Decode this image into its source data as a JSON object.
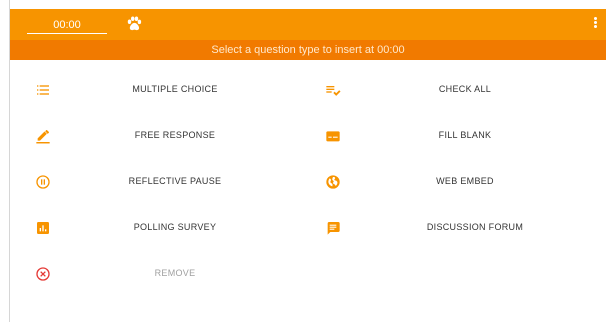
{
  "header": {
    "time_value": "00:00",
    "logo_icon": "paw-icon",
    "menu_icon": "more-vert-icon",
    "bar_color": "#f79400"
  },
  "banner": {
    "text": "Select a question type to insert at 00:00",
    "color": "#f17a00"
  },
  "question_types": [
    {
      "label": "MULTIPLE CHOICE",
      "icon": "list-icon"
    },
    {
      "label": "CHECK ALL",
      "icon": "playlist-check-icon"
    },
    {
      "label": "FREE RESPONSE",
      "icon": "pencil-icon"
    },
    {
      "label": "FILL BLANK",
      "icon": "fill-blank-icon"
    },
    {
      "label": "REFLECTIVE PAUSE",
      "icon": "pause-circle-icon"
    },
    {
      "label": "WEB EMBED",
      "icon": "globe-icon"
    },
    {
      "label": "POLLING SURVEY",
      "icon": "bar-chart-icon"
    },
    {
      "label": "DISCUSSION FORUM",
      "icon": "chat-bubble-icon"
    }
  ],
  "remove": {
    "label": "REMOVE",
    "icon": "remove-circle-icon",
    "color": "#e53935"
  }
}
